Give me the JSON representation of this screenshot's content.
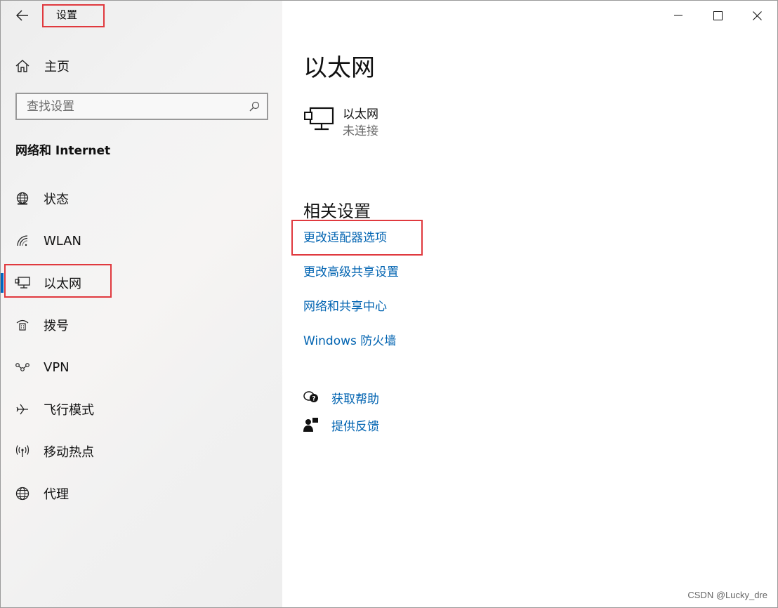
{
  "window": {
    "title": "设置",
    "controls": {
      "minimize": "minimize-icon",
      "maximize": "maximize-icon",
      "close": "close-icon"
    }
  },
  "sidebar": {
    "home_label": "主页",
    "search_placeholder": "查找设置",
    "section_title": "网络和 Internet",
    "items": [
      {
        "label": "状态",
        "icon": "globe-status-icon"
      },
      {
        "label": "WLAN",
        "icon": "wifi-icon"
      },
      {
        "label": "以太网",
        "icon": "ethernet-icon",
        "active": true
      },
      {
        "label": "拨号",
        "icon": "dialup-icon"
      },
      {
        "label": "VPN",
        "icon": "vpn-icon"
      },
      {
        "label": "飞行模式",
        "icon": "airplane-icon"
      },
      {
        "label": "移动热点",
        "icon": "hotspot-icon"
      },
      {
        "label": "代理",
        "icon": "globe-icon"
      }
    ]
  },
  "main": {
    "title": "以太网",
    "adapter": {
      "name": "以太网",
      "status": "未连接"
    },
    "related_title": "相关设置",
    "links": [
      "更改适配器选项",
      "更改高级共享设置",
      "网络和共享中心",
      "Windows 防火墙"
    ],
    "help": {
      "get_help": "获取帮助",
      "feedback": "提供反馈"
    }
  },
  "watermark": "CSDN @Lucky_dre",
  "colors": {
    "accent": "#0067c0",
    "link": "#0063b1",
    "highlight_box": "#e0393e"
  }
}
